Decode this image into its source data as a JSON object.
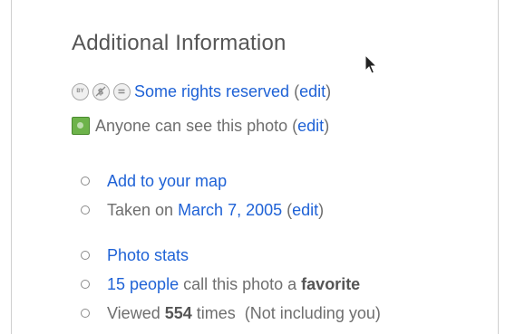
{
  "section": {
    "title": "Additional Information"
  },
  "license": {
    "icons": [
      "cc-by-icon",
      "cc-noncommercial-icon",
      "cc-noderivs-icon"
    ],
    "link_text": "Some rights reserved",
    "open_paren": " (",
    "edit_label": "edit",
    "close_paren": ")"
  },
  "privacy": {
    "icon": "public-privacy-icon",
    "icon_color": "#6db34a",
    "text": "Anyone can see this photo",
    "open_paren": " (",
    "edit_label": "edit",
    "close_paren": ")"
  },
  "map_list": {
    "add_to_map": "Add to your map",
    "taken_prefix": "Taken on ",
    "taken_date": "March 7, 2005",
    "open_paren": " (",
    "edit_label": "edit",
    "close_paren": ")"
  },
  "stats_list": {
    "photo_stats": "Photo stats",
    "people_link": "15 people",
    "favorite_middle": " call this photo a ",
    "favorite_word": "favorite",
    "viewed_prefix": "Viewed ",
    "view_count": "554",
    "viewed_suffix": " times  (Not including you)"
  },
  "colors": {
    "link": "#1f62d6",
    "text": "#6e6e6e",
    "heading": "#555555"
  }
}
